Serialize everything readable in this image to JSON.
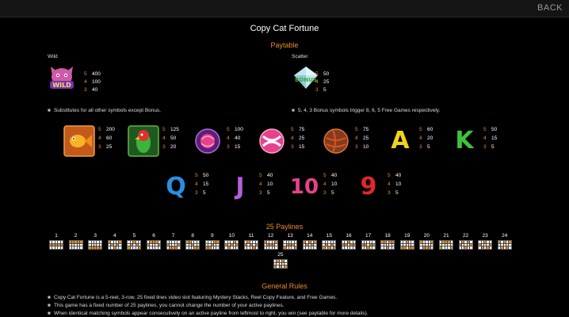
{
  "header": {
    "back_label": "BACK"
  },
  "title": "Copy Cat Fortune",
  "paytable": {
    "title": "Paytable",
    "wild": {
      "label": "Wild",
      "icon": "wild-cat-icon",
      "icon_text": "WILD",
      "pays": [
        {
          "count": "5",
          "value": "400"
        },
        {
          "count": "4",
          "value": "100"
        },
        {
          "count": "3",
          "value": "40"
        }
      ],
      "note": "Substitutes for all other symbols except Bonus."
    },
    "scatter": {
      "label": "Scatter",
      "icon": "bonus-diamond-icon",
      "icon_text": "BONUS",
      "pays": [
        {
          "count": "5",
          "value": "50"
        },
        {
          "count": "4",
          "value": "25"
        },
        {
          "count": "3",
          "value": "5"
        }
      ],
      "note": "5, 4, 3 Bonus symbols trigger 8, 6, 5 Free Games respectively."
    },
    "symbols_row1": [
      {
        "name": "goldfish",
        "icon": "goldfish-icon",
        "pays": [
          {
            "count": "5",
            "value": "200"
          },
          {
            "count": "4",
            "value": "60"
          },
          {
            "count": "3",
            "value": "25"
          }
        ]
      },
      {
        "name": "parrot",
        "icon": "parrot-icon",
        "pays": [
          {
            "count": "5",
            "value": "125"
          },
          {
            "count": "4",
            "value": "50"
          },
          {
            "count": "3",
            "value": "20"
          }
        ]
      },
      {
        "name": "yarn",
        "icon": "yarn-ball-icon",
        "pays": [
          {
            "count": "5",
            "value": "100"
          },
          {
            "count": "4",
            "value": "40"
          },
          {
            "count": "3",
            "value": "15"
          }
        ]
      },
      {
        "name": "pink-ball",
        "icon": "pink-ball-icon",
        "pays": [
          {
            "count": "5",
            "value": "75"
          },
          {
            "count": "4",
            "value": "25"
          },
          {
            "count": "3",
            "value": "15"
          }
        ]
      },
      {
        "name": "brown-ball",
        "icon": "brown-ball-icon",
        "pays": [
          {
            "count": "5",
            "value": "75"
          },
          {
            "count": "4",
            "value": "25"
          },
          {
            "count": "3",
            "value": "10"
          }
        ]
      },
      {
        "name": "A",
        "icon": "letter-a-icon",
        "text": "A",
        "color": "#f2d21b",
        "pays": [
          {
            "count": "5",
            "value": "60"
          },
          {
            "count": "4",
            "value": "20"
          },
          {
            "count": "3",
            "value": "5"
          }
        ]
      },
      {
        "name": "K",
        "icon": "letter-k-icon",
        "text": "K",
        "color": "#3cc43c",
        "pays": [
          {
            "count": "5",
            "value": "50"
          },
          {
            "count": "4",
            "value": "15"
          },
          {
            "count": "3",
            "value": "5"
          }
        ]
      }
    ],
    "symbols_row2": [
      {
        "name": "Q",
        "icon": "letter-q-icon",
        "text": "Q",
        "color": "#2a8fe0",
        "pays": [
          {
            "count": "5",
            "value": "50"
          },
          {
            "count": "4",
            "value": "15"
          },
          {
            "count": "3",
            "value": "5"
          }
        ]
      },
      {
        "name": "J",
        "icon": "letter-j-icon",
        "text": "J",
        "color": "#b45fd8",
        "pays": [
          {
            "count": "5",
            "value": "40"
          },
          {
            "count": "4",
            "value": "10"
          },
          {
            "count": "3",
            "value": "5"
          }
        ]
      },
      {
        "name": "10",
        "icon": "number-10-icon",
        "text": "10",
        "color": "#e8418c",
        "pays": [
          {
            "count": "5",
            "value": "40"
          },
          {
            "count": "4",
            "value": "10"
          },
          {
            "count": "3",
            "value": "5"
          }
        ]
      },
      {
        "name": "9",
        "icon": "number-9-icon",
        "text": "9",
        "color": "#e02828",
        "pays": [
          {
            "count": "5",
            "value": "40"
          },
          {
            "count": "4",
            "value": "10"
          },
          {
            "count": "3",
            "value": "5"
          }
        ]
      }
    ]
  },
  "paylines": {
    "title": "25 Paylines",
    "lines": [
      {
        "n": "1",
        "rows": [
          1,
          1,
          1,
          1,
          1
        ]
      },
      {
        "n": "2",
        "rows": [
          0,
          0,
          0,
          0,
          0
        ]
      },
      {
        "n": "3",
        "rows": [
          2,
          2,
          2,
          2,
          2
        ]
      },
      {
        "n": "4",
        "rows": [
          0,
          1,
          2,
          1,
          0
        ]
      },
      {
        "n": "5",
        "rows": [
          2,
          1,
          0,
          1,
          2
        ]
      },
      {
        "n": "6",
        "rows": [
          1,
          0,
          0,
          0,
          1
        ]
      },
      {
        "n": "7",
        "rows": [
          1,
          2,
          2,
          2,
          1
        ]
      },
      {
        "n": "8",
        "rows": [
          0,
          0,
          1,
          2,
          2
        ]
      },
      {
        "n": "9",
        "rows": [
          2,
          2,
          1,
          0,
          0
        ]
      },
      {
        "n": "10",
        "rows": [
          1,
          2,
          1,
          0,
          1
        ]
      },
      {
        "n": "11",
        "rows": [
          1,
          0,
          1,
          2,
          1
        ]
      },
      {
        "n": "12",
        "rows": [
          0,
          1,
          1,
          1,
          0
        ]
      },
      {
        "n": "13",
        "rows": [
          2,
          1,
          1,
          1,
          2
        ]
      },
      {
        "n": "14",
        "rows": [
          0,
          1,
          0,
          1,
          0
        ]
      },
      {
        "n": "15",
        "rows": [
          2,
          1,
          2,
          1,
          2
        ]
      },
      {
        "n": "16",
        "rows": [
          1,
          1,
          0,
          1,
          1
        ]
      },
      {
        "n": "17",
        "rows": [
          1,
          1,
          2,
          1,
          1
        ]
      },
      {
        "n": "18",
        "rows": [
          0,
          0,
          2,
          0,
          0
        ]
      },
      {
        "n": "19",
        "rows": [
          2,
          2,
          0,
          2,
          2
        ]
      },
      {
        "n": "20",
        "rows": [
          0,
          2,
          2,
          2,
          0
        ]
      },
      {
        "n": "21",
        "rows": [
          2,
          0,
          0,
          0,
          2
        ]
      },
      {
        "n": "22",
        "rows": [
          1,
          0,
          2,
          0,
          1
        ]
      },
      {
        "n": "23",
        "rows": [
          1,
          2,
          0,
          2,
          1
        ]
      },
      {
        "n": "24",
        "rows": [
          0,
          2,
          0,
          2,
          0
        ]
      },
      {
        "n": "25",
        "rows": [
          2,
          0,
          2,
          0,
          2
        ]
      }
    ]
  },
  "rules": {
    "title": "General Rules",
    "items": [
      "Copy Cat Fortune is a 5-reel, 3-row, 25 fixed lines video slot featuring Mystery Stacks, Reel Copy Feature, and Free Games.",
      "This game has a fixed number of 25 paylines, you cannot change the number of your active paylines.",
      "When identical matching symbols appear consecutively on an active payline from leftmost to right, you win (see paytable for more details)."
    ]
  },
  "colors": {
    "accent": "#e88c2c",
    "background": "#000000"
  }
}
